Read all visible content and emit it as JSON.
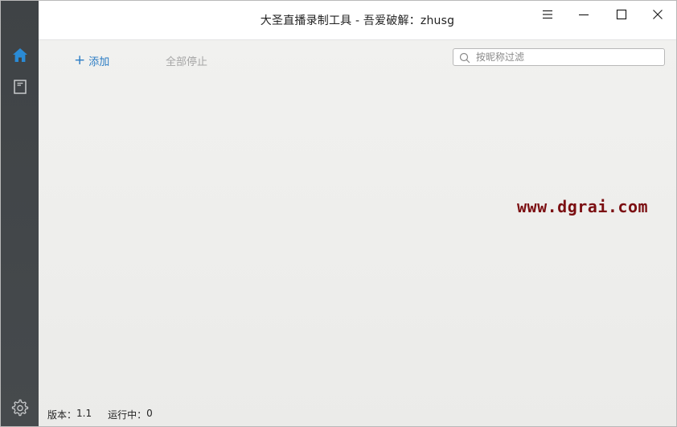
{
  "window": {
    "title": "大圣直播录制工具 - 吾爱破解：zhusg"
  },
  "sidebar": {
    "items": [
      {
        "name": "home",
        "icon": "home-icon",
        "active": true
      },
      {
        "name": "log",
        "icon": "log-book-icon",
        "active": false
      },
      {
        "name": "settings",
        "icon": "gear-icon",
        "active": false
      }
    ]
  },
  "toolbar": {
    "add_label": "添加",
    "stop_all_label": "全部停止"
  },
  "search": {
    "placeholder": "按昵称过滤",
    "value": ""
  },
  "watermark": {
    "text": "www.dgrai.com"
  },
  "status": {
    "version_label": "版本：",
    "version_value": "1.1",
    "running_label": "运行中：",
    "running_value": "0"
  },
  "colors": {
    "accent": "#2b7cc4",
    "sidebar": "#43474a",
    "watermark": "#7b0f12",
    "disabled_text": "#a5a5a5"
  }
}
